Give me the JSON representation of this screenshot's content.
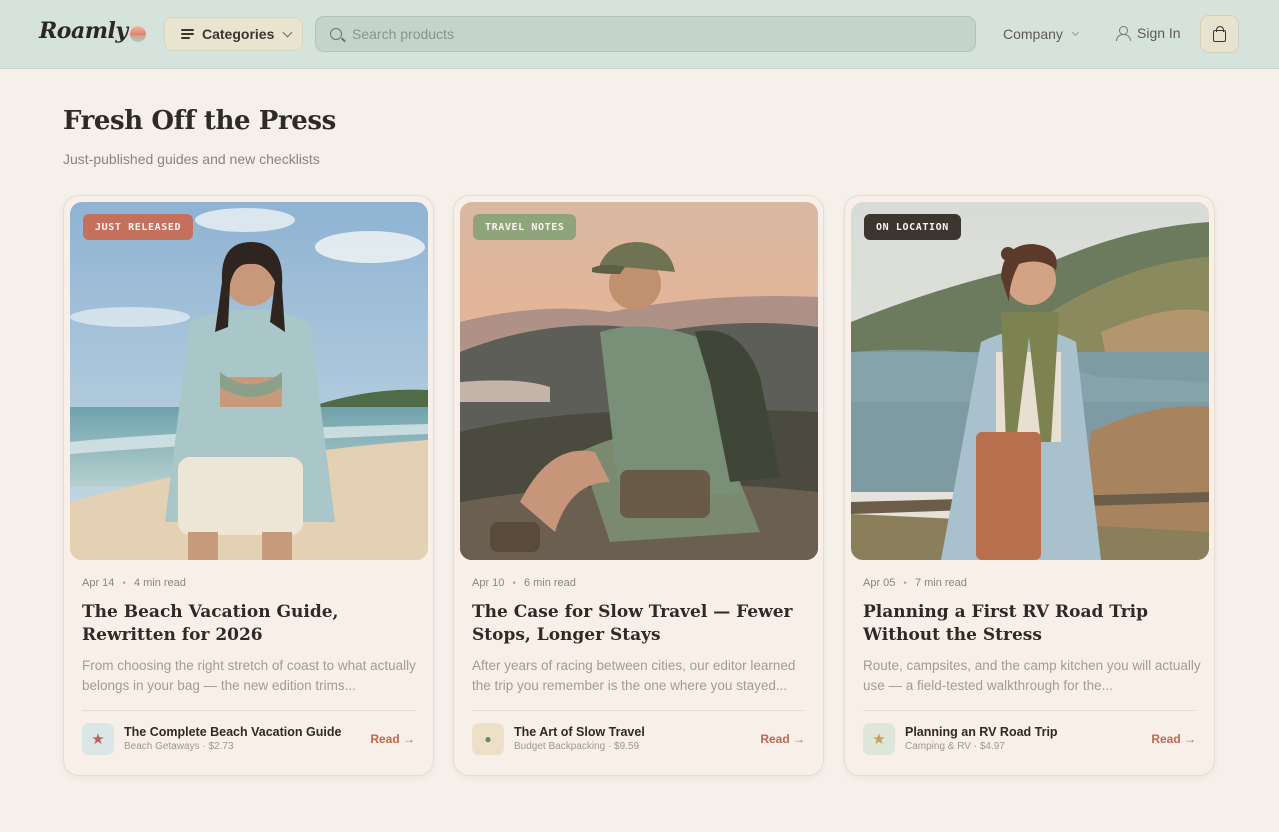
{
  "header": {
    "logo": "Roamly",
    "categories_label": "Categories",
    "search_placeholder": "Search products",
    "company_label": "Company",
    "signin_label": "Sign In"
  },
  "section": {
    "title": "Fresh Off the Press",
    "subtitle": "Just-published guides and new checklists"
  },
  "cards": [
    {
      "badge": "JUST RELEASED",
      "badge_color": "#c5705c",
      "date": "Apr 14",
      "read_time": "4 min read",
      "title": "The Beach Vacation Guide, Rewritten for 2026",
      "excerpt": "From choosing the right stretch of coast to what actually belongs in your bag — the new edition trims...",
      "product_icon": "star-icon",
      "product_icon_glyph": "★",
      "product_icon_color": "#c0605a",
      "product_icon_bg": "#dbe7e6",
      "product_name": "The Complete Beach Vacation Guide",
      "product_sub": "Beach Getaways · $2.73",
      "read_label": "Read →"
    },
    {
      "badge": "TRAVEL NOTES",
      "badge_color": "#8ea57c",
      "date": "Apr 10",
      "read_time": "6 min read",
      "title": "The Case for Slow Travel — Fewer Stops, Longer Stays",
      "excerpt": "After years of racing between cities, our editor learned the trip you remember is the one where you stayed...",
      "product_icon": "map-pin-icon",
      "product_icon_glyph": "●",
      "product_icon_color": "#6f8a5a",
      "product_icon_bg": "#ece1c8",
      "product_name": "The Art of Slow Travel",
      "product_sub": "Budget Backpacking · $9.59",
      "read_label": "Read →"
    },
    {
      "badge": "ON LOCATION",
      "badge_color": "#3d3630",
      "date": "Apr 05",
      "read_time": "7 min read",
      "title": "Planning a First RV Road Trip Without the Stress",
      "excerpt": "Route, campsites, and the camp kitchen you will actually use — a field-tested walkthrough for the...",
      "product_icon": "star-icon",
      "product_icon_glyph": "★",
      "product_icon_color": "#c9a24a",
      "product_icon_bg": "#dde6d8",
      "product_name": "Planning an RV Road Trip",
      "product_sub": "Camping & RV · $4.97",
      "read_label": "Read →"
    }
  ]
}
